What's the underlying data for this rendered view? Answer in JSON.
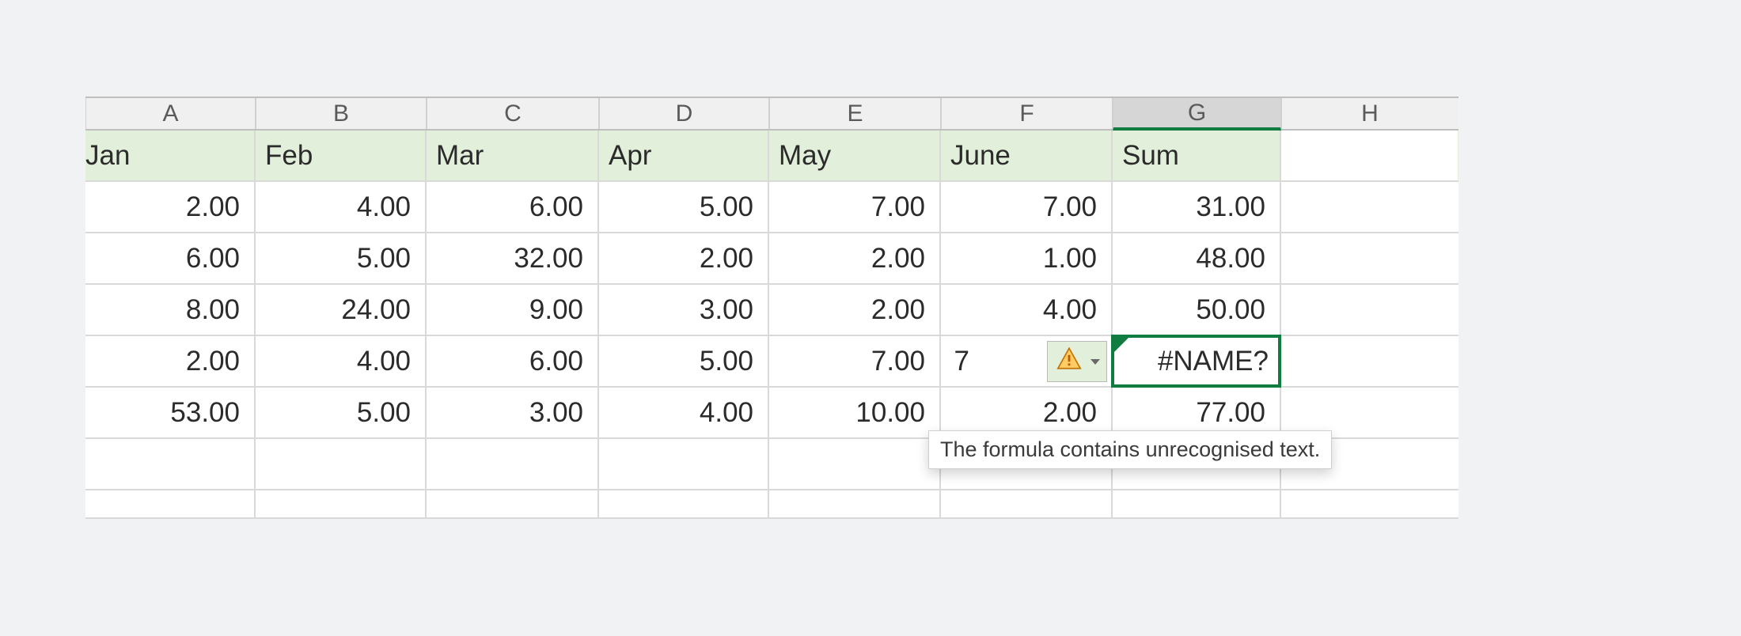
{
  "columns": [
    "A",
    "B",
    "C",
    "D",
    "E",
    "F",
    "G",
    "H"
  ],
  "selected_column_index": 6,
  "header_row": [
    "Jan",
    "Feb",
    "Mar",
    "Apr",
    "May",
    "June",
    "Sum",
    ""
  ],
  "rows": [
    [
      "2.00",
      "4.00",
      "6.00",
      "5.00",
      "7.00",
      "7.00",
      "31.00",
      ""
    ],
    [
      "6.00",
      "5.00",
      "32.00",
      "2.00",
      "2.00",
      "1.00",
      "48.00",
      ""
    ],
    [
      "8.00",
      "24.00",
      "9.00",
      "3.00",
      "2.00",
      "4.00",
      "50.00",
      ""
    ],
    [
      "2.00",
      "4.00",
      "6.00",
      "5.00",
      "7.00",
      "7.00",
      "#NAME?",
      ""
    ],
    [
      "53.00",
      "5.00",
      "3.00",
      "4.00",
      "10.00",
      "2.00",
      "77.00",
      ""
    ]
  ],
  "row5_f_partial_left": "7",
  "selected_cell": {
    "row": 3,
    "col": 6,
    "value": "#NAME?"
  },
  "error_tooltip": "The formula contains unrecognised text.",
  "error_icon_name": "warning-triangle-icon"
}
